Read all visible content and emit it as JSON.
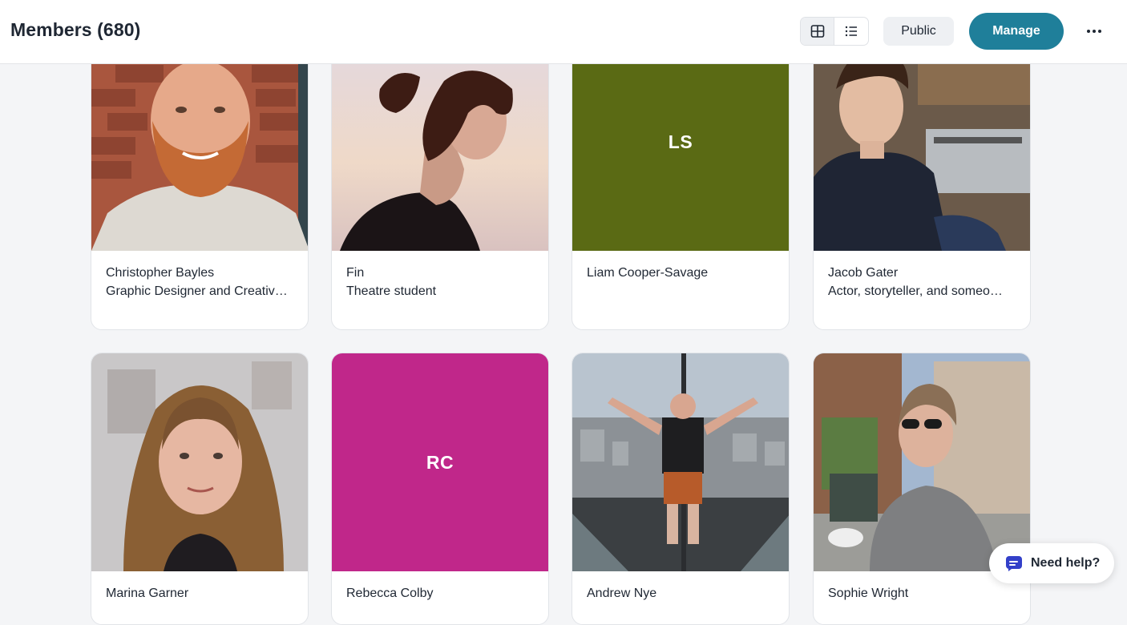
{
  "header": {
    "title": "Members (680)",
    "public_label": "Public",
    "manage_label": "Manage",
    "grid_view_icon": "grid-icon",
    "list_view_icon": "list-icon",
    "more_icon": "more-horizontal-icon"
  },
  "members": [
    {
      "name": "Christopher Bayles",
      "bio": "Graphic Designer and Creativ…",
      "avatar": "photo"
    },
    {
      "name": "Fin",
      "bio": "Theatre student",
      "avatar": "photo"
    },
    {
      "name": "Liam Cooper-Savage",
      "bio": "",
      "avatar": "initials",
      "initials": "LS",
      "color": "#5a6a14"
    },
    {
      "name": "Jacob Gater",
      "bio": "Actor, storyteller, and someo…",
      "avatar": "photo"
    },
    {
      "name": "Marina Garner",
      "bio": "",
      "avatar": "photo"
    },
    {
      "name": "Rebecca Colby",
      "bio": "",
      "avatar": "initials",
      "initials": "RC",
      "color": "#c0278a"
    },
    {
      "name": "Andrew Nye",
      "bio": "",
      "avatar": "photo"
    },
    {
      "name": "Sophie Wright",
      "bio": "",
      "avatar": "photo"
    }
  ],
  "help": {
    "label": "Need help?",
    "icon": "chat-bubble-icon",
    "accent": "#3340c9"
  },
  "colors": {
    "brand": "#1f7f9a",
    "page_bg": "#f4f5f7"
  }
}
